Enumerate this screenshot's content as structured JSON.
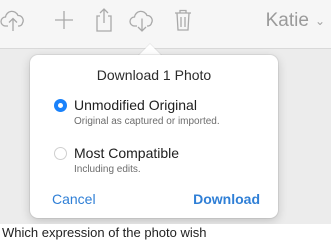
{
  "toolbar": {
    "icons": [
      "cloud-upload-icon",
      "plus-icon",
      "share-icon",
      "cloud-download-icon",
      "trash-icon"
    ],
    "user_name": "Katie",
    "icon_color": "#a9a9a9"
  },
  "dialog": {
    "title": "Download 1 Photo",
    "options": [
      {
        "label": "Unmodified Original",
        "description": "Original as captured or imported.",
        "selected": true
      },
      {
        "label": "Most Compatible",
        "description": "Including edits.",
        "selected": false
      }
    ],
    "cancel_label": "Cancel",
    "download_label": "Download",
    "accent_color": "#1a82fb"
  },
  "footer": {
    "text": "Which expression of the photo wish"
  }
}
